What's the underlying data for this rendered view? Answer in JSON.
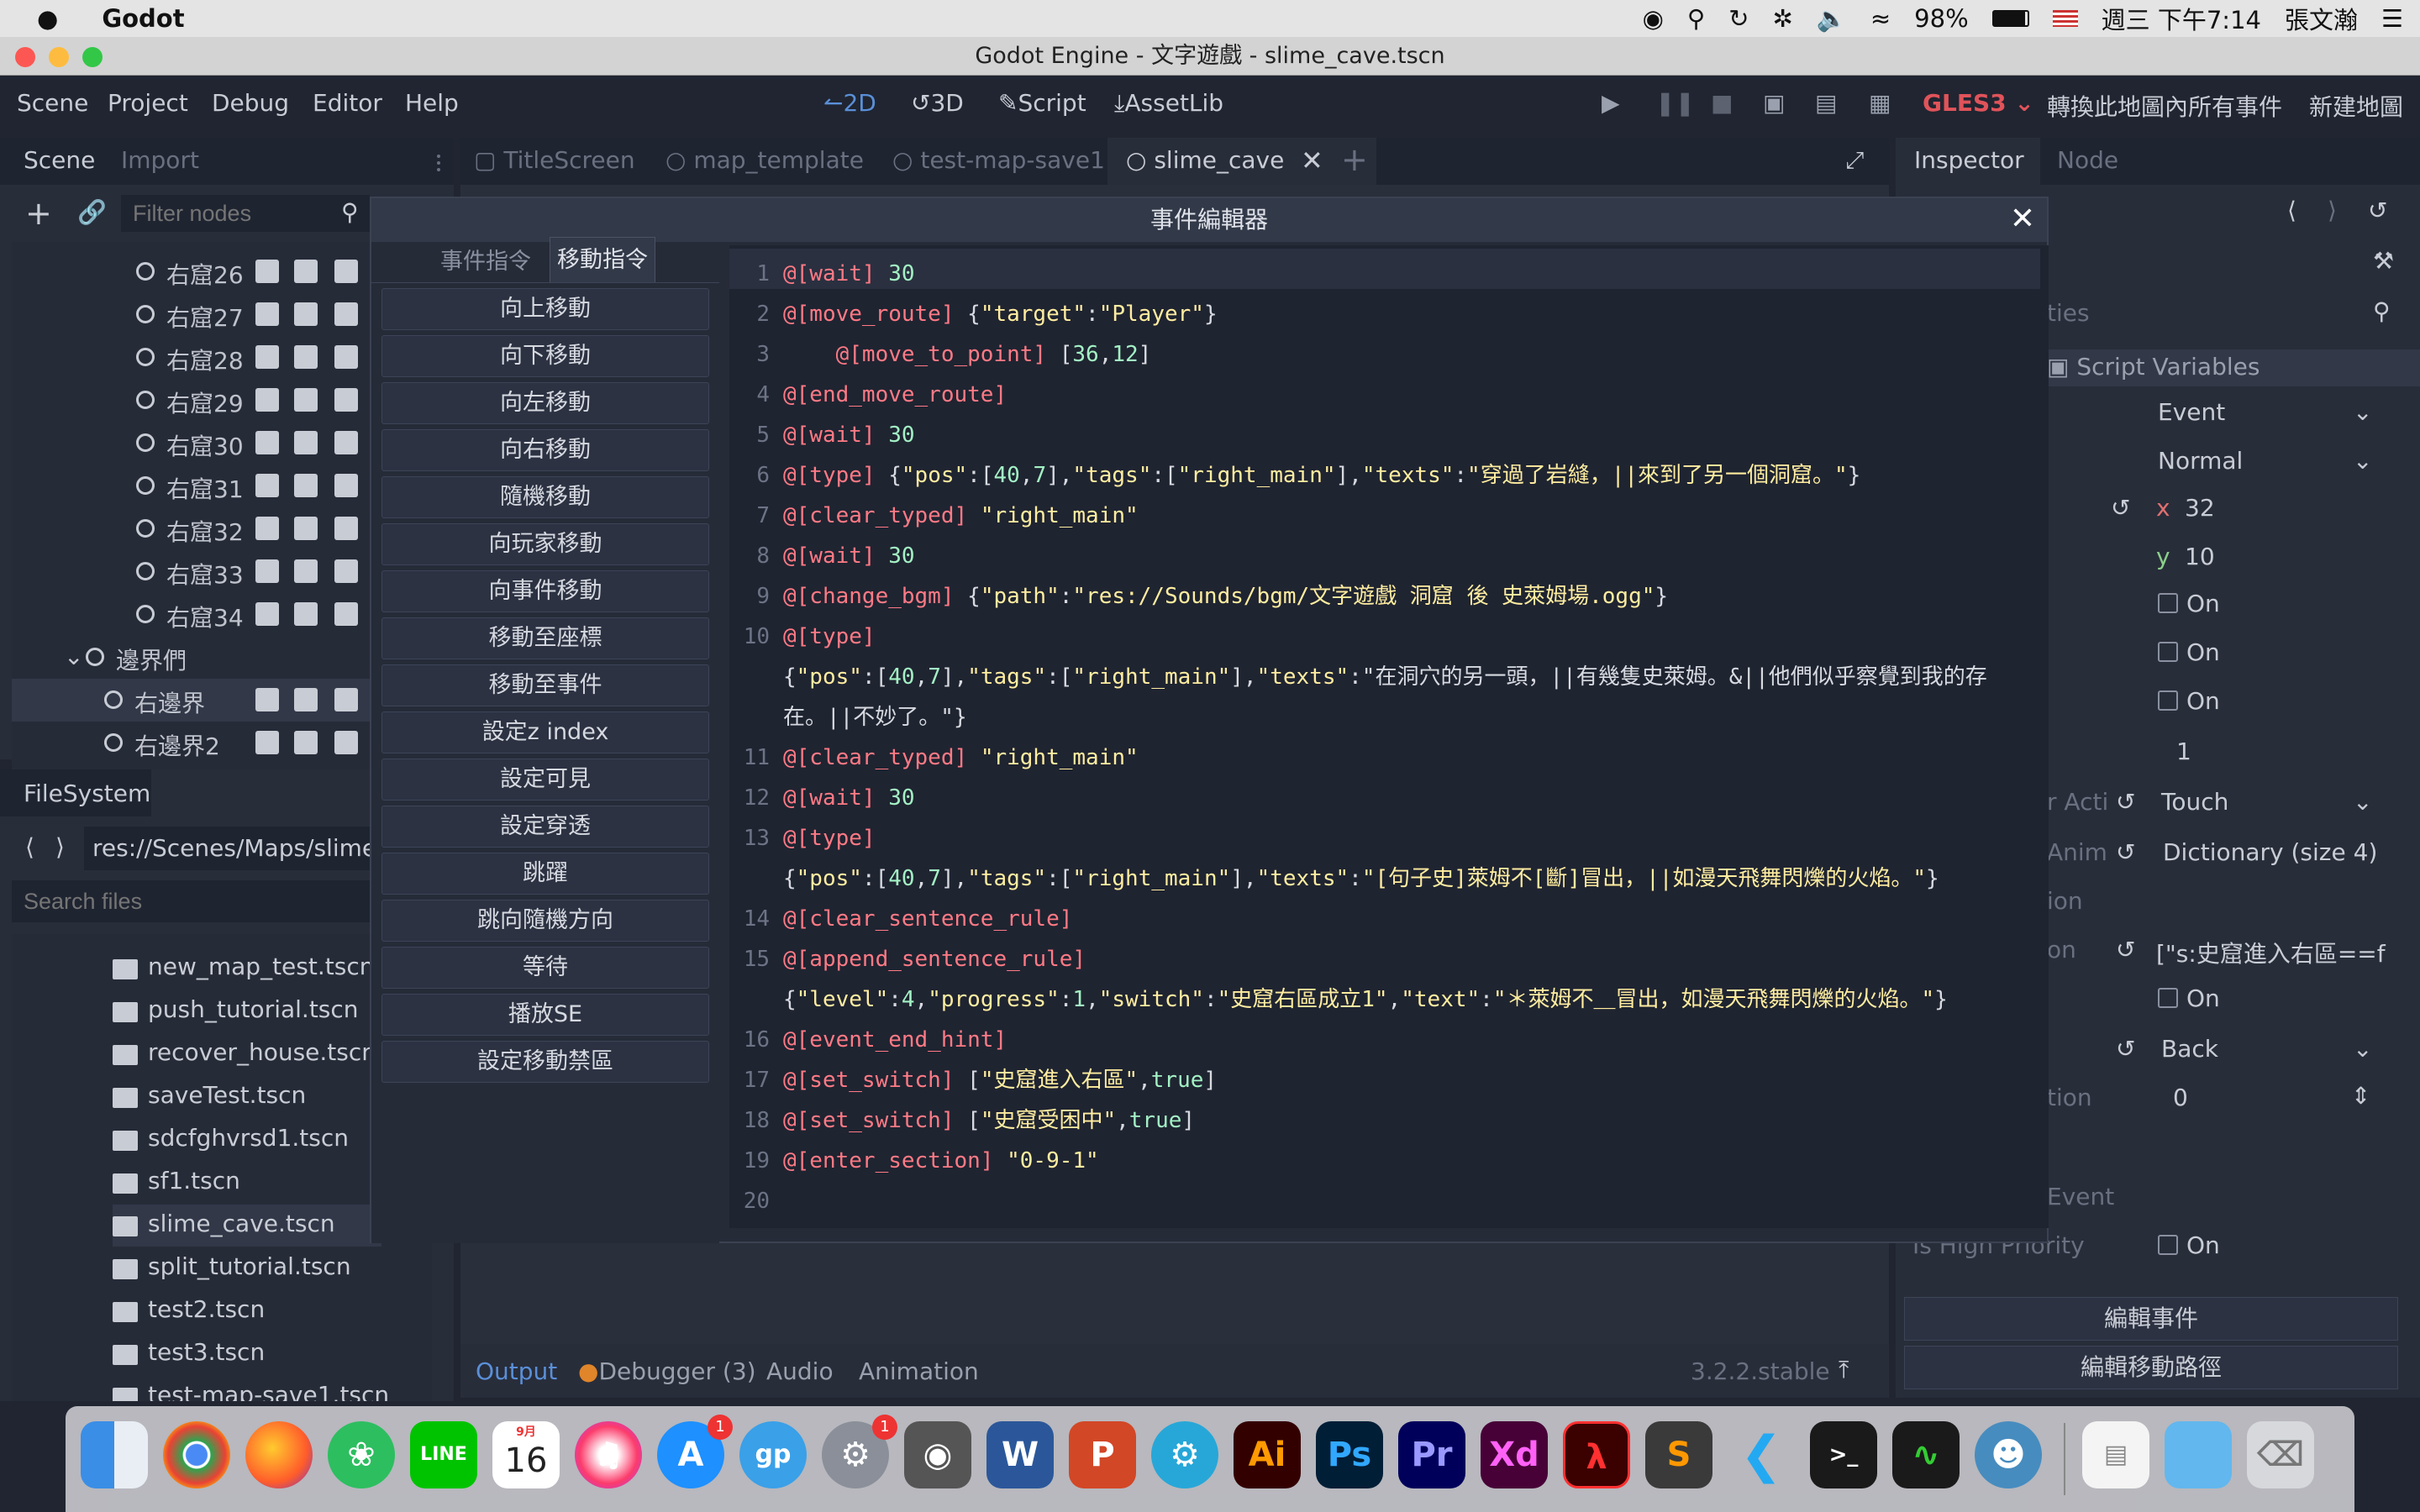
{
  "menubar": {
    "app": "Godot",
    "battery": "98%",
    "datetime": "週三 下午7:14",
    "user": "張文瀚"
  },
  "window": {
    "title": "Godot Engine - 文字遊戲 - slime_cave.tscn"
  },
  "menu": {
    "scene": "Scene",
    "project": "Project",
    "debug": "Debug",
    "editor": "Editor",
    "help": "Help"
  },
  "workspaces": {
    "w2d": "2D",
    "w3d": "3D",
    "script": "Script",
    "assetlib": "AssetLib"
  },
  "toolbar": {
    "renderer": "GLES3",
    "convert": "轉換此地圖內所有事件",
    "new_map": "新建地圖"
  },
  "scene_dock": {
    "tab_scene": "Scene",
    "tab_import": "Import",
    "filter_placeholder": "Filter nodes",
    "nodes": [
      "右窟26",
      "右窟27",
      "右窟28",
      "右窟29",
      "右窟30",
      "右窟31",
      "右窟32",
      "右窟33",
      "右窟34"
    ],
    "group": "邊界們",
    "selected": "右邊界",
    "partial": "右邊界2"
  },
  "editor_tabs": [
    "TitleScreen",
    "map_template",
    "test-map-save1",
    "slime_cave"
  ],
  "filesystem": {
    "title": "FileSystem",
    "path": "res://Scenes/Maps/slime_c",
    "search_placeholder": "Search files",
    "files": [
      "new_map_test.tscn",
      "push_tutorial.tscn",
      "recover_house.tscn",
      "saveTest.tscn",
      "sdcfghvrsd1.tscn",
      "sf1.tscn",
      "slime_cave.tscn",
      "split_tutorial.tscn",
      "test2.tscn",
      "test3.tscn",
      "test-map-save1.tscn"
    ]
  },
  "dialog": {
    "title": "事件編輯器",
    "tab_events": "事件指令",
    "tab_move": "移動指令",
    "buttons": [
      "向上移動",
      "向下移動",
      "向左移動",
      "向右移動",
      "隨機移動",
      "向玩家移動",
      "向事件移動",
      "移動至座標",
      "移動至事件",
      "設定z index",
      "設定可見",
      "設定穿透",
      "跳躍",
      "跳向隨機方向",
      "等待",
      "播放SE",
      "設定移動禁區"
    ]
  },
  "code": [
    {
      "n": "1",
      "kw": "@[wait]",
      "rest": " 30"
    },
    {
      "n": "2",
      "kw": "@[move_route]",
      "rest": " {\"target\":\"Player\"}"
    },
    {
      "n": "3",
      "kw": "    @[move_to_point]",
      "rest": " [36,12]"
    },
    {
      "n": "4",
      "kw": "@[end_move_route]",
      "rest": ""
    },
    {
      "n": "5",
      "kw": "@[wait]",
      "rest": " 30"
    },
    {
      "n": "6",
      "kw": "@[type]",
      "rest": " {\"pos\":[40,7],\"tags\":[\"right_main\"],\"texts\":\"穿過了岩縫，||來到了另一個洞窟。\"}"
    },
    {
      "n": "7",
      "kw": "@[clear_typed]",
      "rest": " \"right_main\""
    },
    {
      "n": "8",
      "kw": "@[wait]",
      "rest": " 30"
    },
    {
      "n": "9",
      "kw": "@[change_bgm]",
      "rest": " {\"path\":\"res://Sounds/bgm/文字遊戲 洞窟 後 史萊姆場.ogg\"}"
    },
    {
      "n": "10",
      "kw": "@[type]",
      "rest": ""
    },
    {
      "n": "",
      "kw": "",
      "rest": "{\"pos\":[40,7],\"tags\":[\"right_main\"],\"texts\":\"在洞穴的另一頭，||有幾隻史萊姆。&||他們似乎察覺到我的存"
    },
    {
      "n": "",
      "kw": "",
      "rest": "在。||不妙了。\"}"
    },
    {
      "n": "11",
      "kw": "@[clear_typed]",
      "rest": " \"right_main\""
    },
    {
      "n": "12",
      "kw": "@[wait]",
      "rest": " 30"
    },
    {
      "n": "13",
      "kw": "@[type]",
      "rest": ""
    },
    {
      "n": "",
      "kw": "",
      "rest": "{\"pos\":[40,7],\"tags\":[\"right_main\"],\"texts\":\"[句子史]萊姆不[斷]冒出，||如漫天飛舞閃爍的火焰。\"}"
    },
    {
      "n": "14",
      "kw": "@[clear_sentence_rule]",
      "rest": ""
    },
    {
      "n": "15",
      "kw": "@[append_sentence_rule]",
      "rest": ""
    },
    {
      "n": "",
      "kw": "",
      "rest": "{\"level\":4,\"progress\":1,\"switch\":\"史窟右區成立1\",\"text\":\"＊萊姆不＿冒出，如漫天飛舞閃爍的火焰。\"}"
    },
    {
      "n": "16",
      "kw": "@[event_end_hint]",
      "rest": ""
    },
    {
      "n": "17",
      "kw": "@[set_switch]",
      "rest": " [\"史窟進入右區\",true]"
    },
    {
      "n": "18",
      "kw": "@[set_switch]",
      "rest": " [\"史窟受困中\",true]"
    },
    {
      "n": "19",
      "kw": "@[enter_section]",
      "rest": " \"0-9-1\""
    },
    {
      "n": "20",
      "kw": "",
      "rest": ""
    }
  ],
  "inspector": {
    "tab_inspector": "Inspector",
    "tab_node": "Node",
    "props_partial": "ties",
    "script_vars": "Script Variables",
    "event": "Event",
    "normal": "Normal",
    "x_label": "x",
    "x": "32",
    "y_label": "y",
    "y": "10",
    "on": "On",
    "one": "1",
    "act_label": "r Acti",
    "touch": "Touch",
    "anim_label": "Anim",
    "dictionary": "Dictionary (size 4)",
    "ion": "ion",
    "on_label": "on",
    "array": "[\"s:史窟進入右區==f",
    "back": "Back",
    "tion": "tion",
    "zero": "0",
    "vent": "Event",
    "high_priority": "Is High Priority",
    "edit_event": "編輯事件",
    "edit_path": "編輯移動路徑"
  },
  "bottom": {
    "output": "Output",
    "debugger": "Debugger (3)",
    "audio": "Audio",
    "animation": "Animation",
    "version": "3.2.2.stable"
  },
  "dock": {
    "calendar_month": "9月",
    "calendar_day": "16",
    "badge": "1"
  }
}
